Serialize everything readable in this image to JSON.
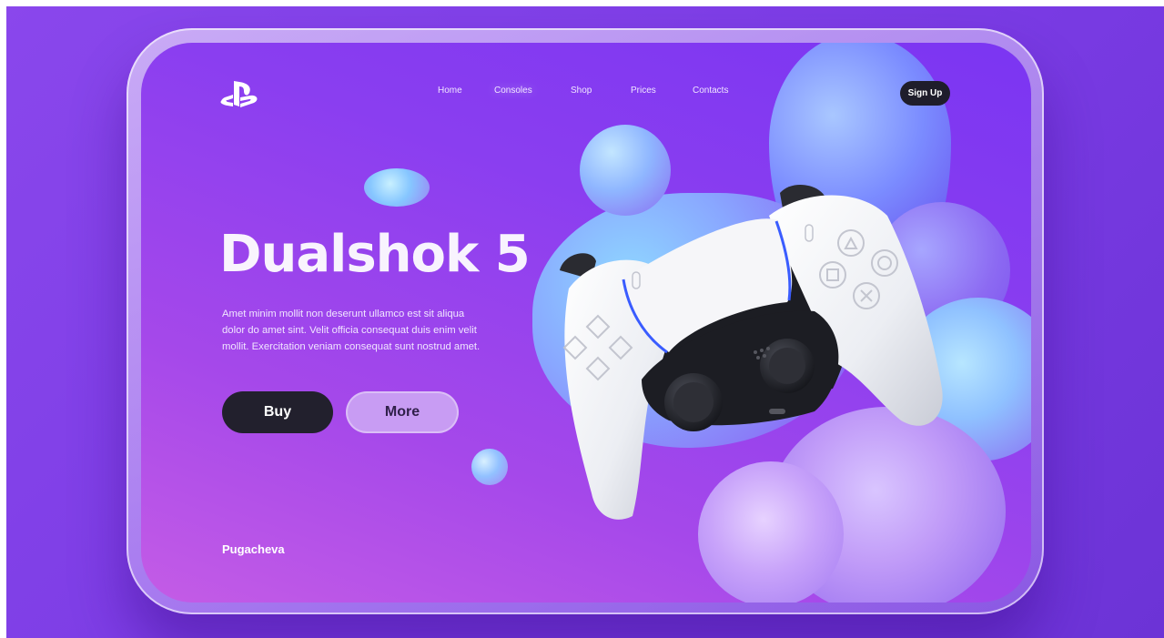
{
  "header": {
    "nav": [
      "Home",
      "Consoles",
      "Shop",
      "Prices",
      "Contacts"
    ],
    "signup_label": "Sign Up",
    "logo_icon": "playstation-logo-icon"
  },
  "hero": {
    "title": "Dualshok 5",
    "description": "Amet minim mollit non deserunt ullamco est sit aliqua dolor do amet sint. Velit officia consequat duis enim velit mollit. Exercitation veniam consequat sunt nostrud amet.",
    "buy_label": "Buy",
    "more_label": "More"
  },
  "footer": {
    "brand": "Pugacheva"
  },
  "colors": {
    "background": "#8a47ec",
    "screen": "#8a3ef0",
    "button_dark": "#22202d",
    "button_light": "#c89cf3"
  }
}
